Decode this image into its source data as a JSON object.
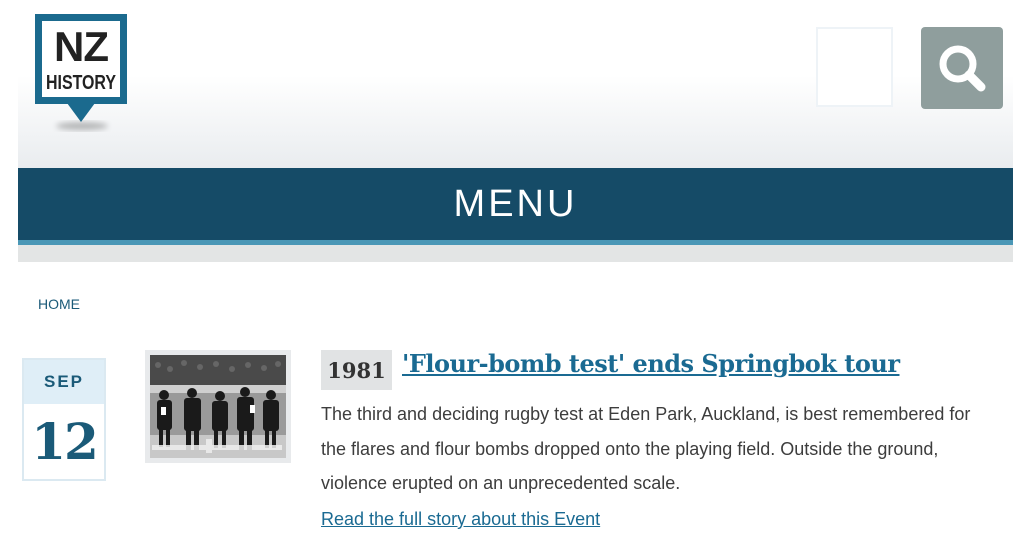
{
  "header": {
    "logo": {
      "line1": "NZ",
      "line2": "HISTORY"
    },
    "search_icon": "search-icon"
  },
  "nav": {
    "menu_label": "MENU"
  },
  "breadcrumb": {
    "home": "HOME"
  },
  "event": {
    "month": "SEP",
    "day": "12",
    "year": "1981",
    "title": "'Flour-bomb test' ends Springbok tour",
    "description": "The third and deciding rugby test at Eden Park, Auckland, is best remembered for the flares and flour bombs dropped onto the playing field. Outside the ground, violence erupted on an unprecedented scale.",
    "read_more": "Read the full story about this Event"
  },
  "colors": {
    "brand_navy": "#154b67",
    "accent_blue": "#4a97b6",
    "link_blue": "#1a6a92",
    "search_grey": "#8f9e9d"
  }
}
